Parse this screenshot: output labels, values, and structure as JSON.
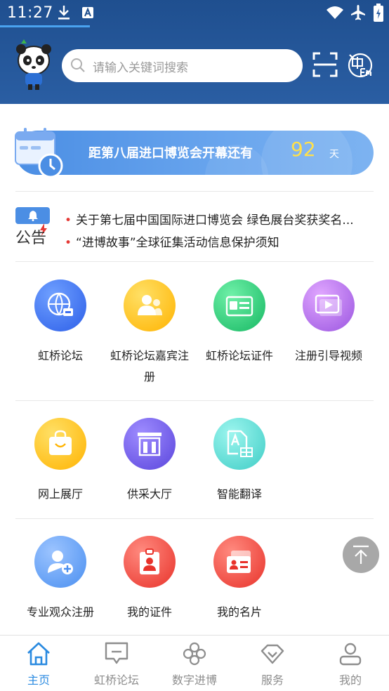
{
  "status_bar": {
    "time": "11:27"
  },
  "header": {
    "search_placeholder": "请输入关键词搜索"
  },
  "countdown": {
    "text": "距第八届进口博览会开幕还有",
    "days": "92",
    "unit": "天"
  },
  "notice": {
    "label": "公告",
    "items": [
      "关于第七届中国国际进口博览会 绿色展台奖获奖名...",
      "“进博故事”全球征集活动信息保护须知"
    ]
  },
  "grid": {
    "row1": [
      {
        "label": "虹桥论坛",
        "color": "#3e6fee"
      },
      {
        "label": "虹桥论坛嘉宾注册",
        "color": "#ffc21a"
      },
      {
        "label": "虹桥论坛证件",
        "color": "#2fcf7b"
      },
      {
        "label": "注册引导视频",
        "color": "#b36fe8"
      }
    ],
    "row2": [
      {
        "label": "网上展厅",
        "color": "#ffc21a"
      },
      {
        "label": "供采大厅",
        "color": "#6a5ae6"
      },
      {
        "label": "智能翻译",
        "color": "#4bd6d0"
      }
    ],
    "row3": [
      {
        "label": "专业观众注册",
        "color": "#4a8ff0"
      },
      {
        "label": "我的证件",
        "color": "#f04438"
      },
      {
        "label": "我的名片",
        "color": "#f04438"
      }
    ]
  },
  "tabbar": {
    "tabs": [
      {
        "label": "主页",
        "active": true
      },
      {
        "label": "虹桥论坛",
        "active": false
      },
      {
        "label": "数字进博",
        "active": false
      },
      {
        "label": "服务",
        "active": false
      },
      {
        "label": "我的",
        "active": false
      }
    ]
  }
}
